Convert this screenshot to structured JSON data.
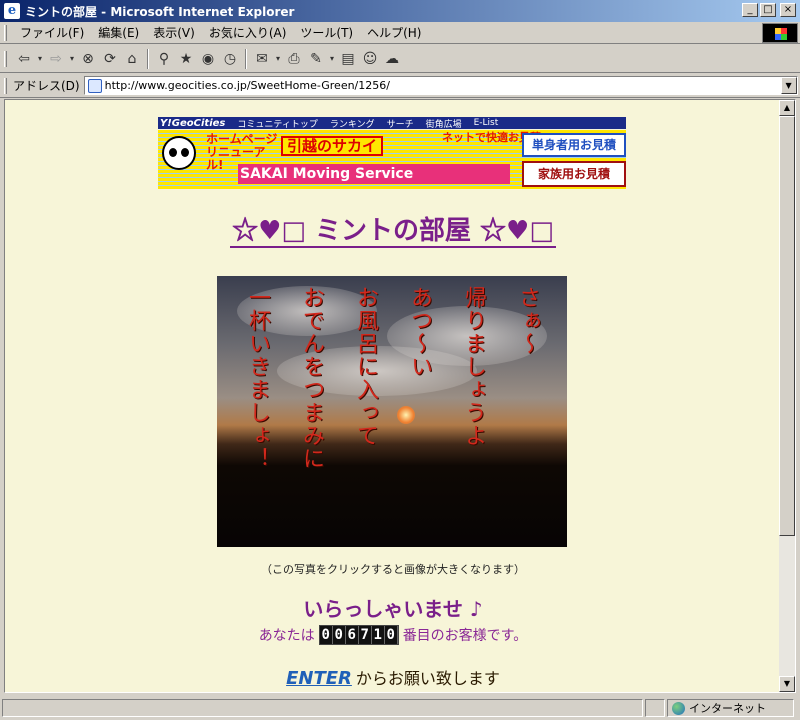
{
  "window": {
    "title": "ミントの部屋 - Microsoft Internet Explorer"
  },
  "menubar": {
    "items": [
      "ファイル(F)",
      "編集(E)",
      "表示(V)",
      "お気に入り(A)",
      "ツール(T)",
      "ヘルプ(H)"
    ]
  },
  "address": {
    "label": "アドレス(D)",
    "url": "http://www.geocities.co.jp/SweetHome-Green/1256/"
  },
  "banner": {
    "logo": "Y!GeoCities",
    "nav": [
      "コミュニティトップ",
      "ランキング",
      "サーチ",
      "街角広場",
      "E-List"
    ],
    "promo_renewal": "ホームページリニューアル!",
    "promo_company": "引越のサカイ",
    "promo_quote": "ネットで快適お見積!",
    "promo_service": "SAKAI Moving Service",
    "button_single": "単身者用お見積",
    "button_family": "家族用お見積"
  },
  "page": {
    "headline": "☆♥□ ミントの部屋 ☆♥□",
    "photo_poem": [
      "さぁ～",
      "帰りましょうよ",
      "あつ～い",
      "お風呂に入って",
      "おでんをつまみに",
      "一杯いきましょ！"
    ],
    "caption": "（この写真をクリックすると画像が大きくなります）",
    "welcome": "いらっしゃいませ ♪",
    "visitor_prefix": "あなたは",
    "visitor_count": "006710",
    "visitor_suffix": "番目のお客様です。",
    "enter_link": "ENTER",
    "enter_suffix": "からお願い致します"
  },
  "status": {
    "zone": "インターネット"
  },
  "colors": {
    "page_bg": "#f7f5d8",
    "heading": "#7a1f8a",
    "link": "#2060b8"
  }
}
